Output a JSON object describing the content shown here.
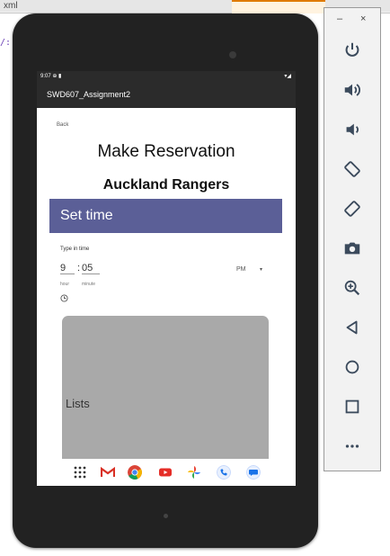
{
  "ide": {
    "tabs": [
      "xml",
      "",
      "",
      "",
      "",
      "",
      ""
    ],
    "code_fragment": "/:"
  },
  "status_bar": {
    "time": "9:07",
    "icons_left": "⊕ ▮",
    "icons_right": "▾◢"
  },
  "app": {
    "app_bar_title": "SWD607_Assignment2",
    "back_label": "Back",
    "page_title": "Make Reservation",
    "team_name": "Auckland Rangers",
    "section_header": "Set time",
    "time_picker": {
      "label": "Type in time",
      "hour": "9",
      "separator": ":",
      "minute": "05",
      "hour_caption": "hour",
      "minute_caption": "minute",
      "period": "PM"
    },
    "card_label": "Lists"
  },
  "nav_bar": {
    "icons": [
      "apps-grid-icon",
      "gmail-icon",
      "chrome-icon",
      "youtube-icon",
      "photos-icon",
      "phone-icon",
      "messages-icon"
    ]
  },
  "emulator_panel": {
    "window_controls": [
      "–",
      "×"
    ],
    "tools": [
      "power-icon",
      "volume-up-icon",
      "volume-down-icon",
      "rotate-left-icon",
      "rotate-right-icon",
      "camera-icon",
      "zoom-icon",
      "back-icon",
      "home-icon",
      "overview-icon",
      "more-icon"
    ]
  },
  "colors": {
    "accent": "#5b5f97",
    "card": "#a9a9a9",
    "device": "#222222",
    "toolbar": "#2b2b2b"
  }
}
